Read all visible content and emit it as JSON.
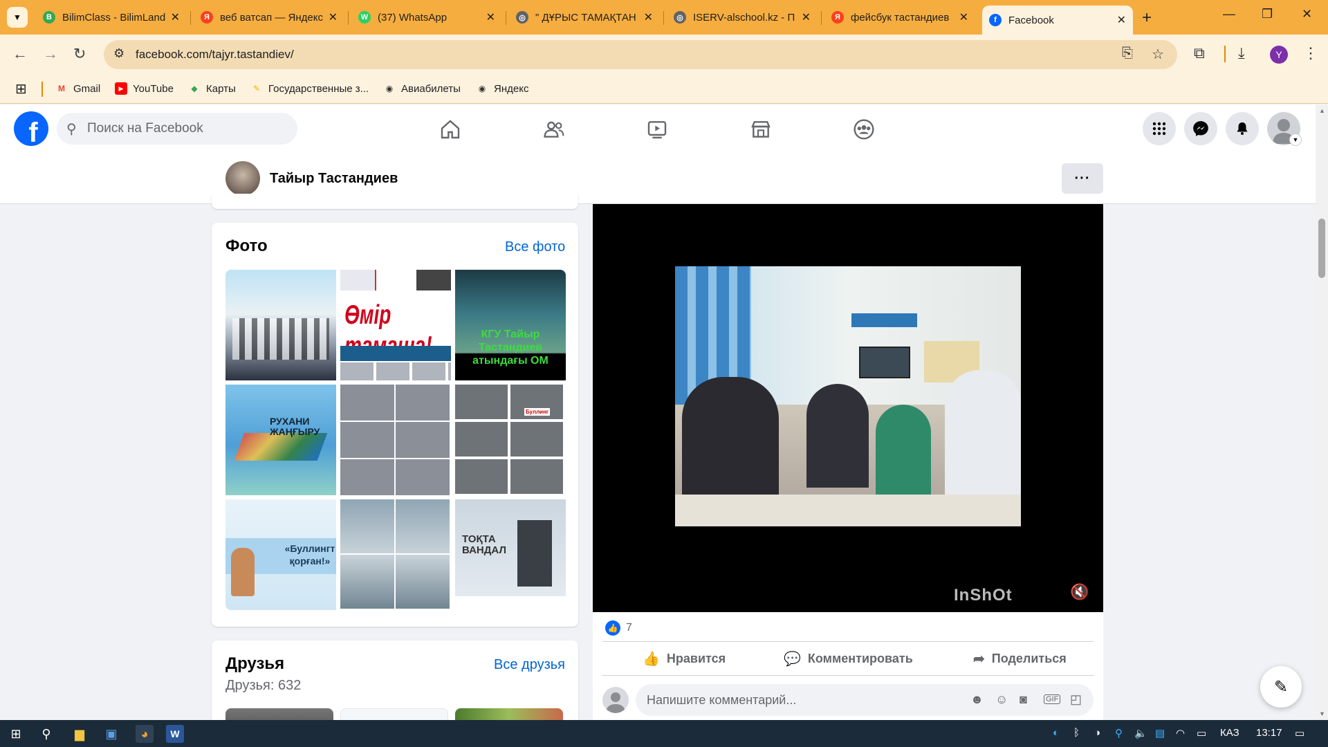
{
  "browser": {
    "tabs": [
      {
        "title": "BilimClass - BilimLand",
        "favicon_color": "#34a853",
        "favicon_char": "B"
      },
      {
        "title": "веб ватсап — Яндекс",
        "favicon_color": "#fc3f1d",
        "favicon_char": "Я"
      },
      {
        "title": "(37) WhatsApp",
        "favicon_color": "#25d366",
        "favicon_char": "W"
      },
      {
        "title": "\" ДҰРЫС ТАМАҚТАН",
        "favicon_color": "#5f6368",
        "favicon_char": "◎"
      },
      {
        "title": "ISERV-alschool.kz - П",
        "favicon_color": "#5f6368",
        "favicon_char": "◎"
      },
      {
        "title": "фейсбук тастандиев",
        "favicon_color": "#fc3f1d",
        "favicon_char": "Я"
      },
      {
        "title": "Facebook",
        "favicon_color": "#0866ff",
        "favicon_char": "f"
      }
    ],
    "url": "facebook.com/tajyr.tastandiev/",
    "profile_initial": "Y",
    "bookmarks": [
      {
        "label": "Gmail",
        "icon": "gmail-icon",
        "color": "#ea4335",
        "char": "M"
      },
      {
        "label": "YouTube",
        "icon": "youtube-icon",
        "color": "#ff0000",
        "char": "▶"
      },
      {
        "label": "Карты",
        "icon": "maps-icon",
        "color": "#34a853",
        "char": "◆"
      },
      {
        "label": "Государственные з...",
        "icon": "gov-icon",
        "color": "#f4b400",
        "char": "✎"
      },
      {
        "label": "Авиабилеты",
        "icon": "globe-icon",
        "color": "#333333",
        "char": "◉"
      },
      {
        "label": "Яндекс",
        "icon": "globe-icon",
        "color": "#333333",
        "char": "◉"
      }
    ]
  },
  "facebook": {
    "search_placeholder": "Поиск на Facebook",
    "profile_name": "Тайыр Тастандиев",
    "photos": {
      "title": "Фото",
      "link": "Все фото",
      "items": [
        {
          "caption": ""
        },
        {
          "caption": "Өмір тамаша!"
        },
        {
          "caption": "КГУ Тайыр Тастандиев атындағы ОМ"
        },
        {
          "caption": "РУХАНИ ЖАҢҒЫРУ"
        },
        {
          "caption": ""
        },
        {
          "caption": "Буллинг"
        },
        {
          "caption": "«Буллингт қорған!»"
        },
        {
          "caption": ""
        },
        {
          "caption": "ТОҚТА ВАНДАЛ"
        }
      ]
    },
    "friends": {
      "title": "Друзья",
      "link": "Все друзья",
      "count": "Друзья: 632"
    },
    "post": {
      "watermark": "InShOt",
      "likes": "7",
      "actions": [
        "Нравится",
        "Комментировать",
        "Поделиться"
      ],
      "comment_placeholder": "Напишите комментарий..."
    }
  },
  "taskbar": {
    "language": "КАЗ",
    "time": "13:17"
  }
}
